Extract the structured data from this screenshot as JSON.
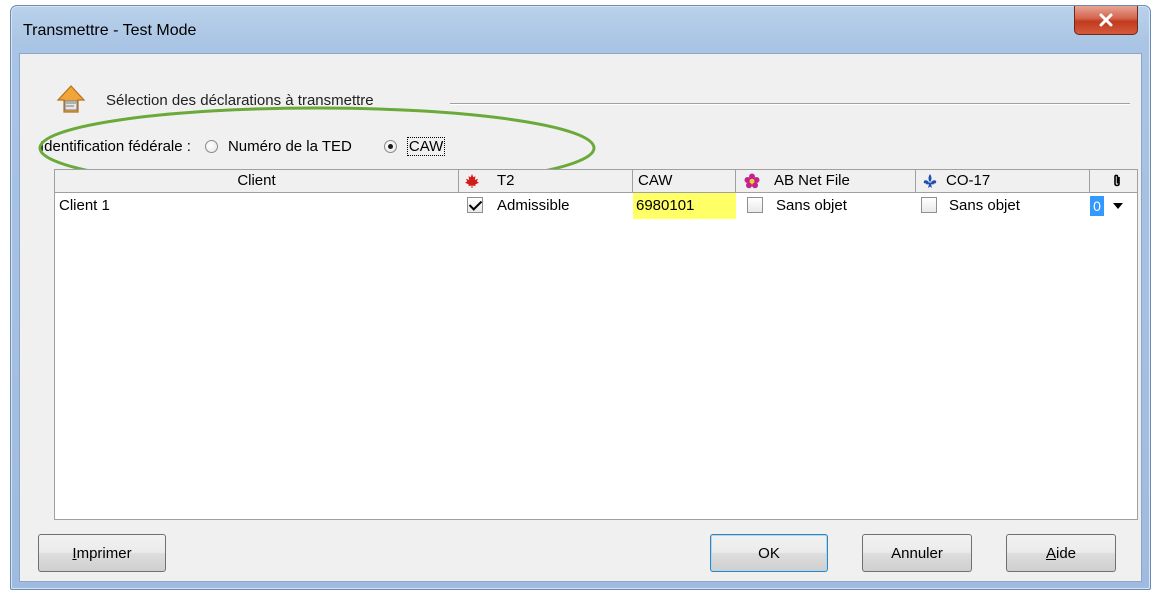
{
  "window": {
    "title": "Transmettre - Test Mode",
    "close_icon": "close-x-icon"
  },
  "section": {
    "title": "Sélection des déclarations à transmettre",
    "icon": "transmit-icon"
  },
  "federal_id": {
    "label": "Identification fédérale :",
    "options": [
      {
        "label": "Numéro de la TED",
        "selected": false
      },
      {
        "label": "CAW",
        "selected": true
      }
    ],
    "highlight_color": "#6aaa3a"
  },
  "grid": {
    "columns": [
      {
        "label": "Client"
      },
      {
        "label": "T2",
        "icon": "maple-leaf-icon"
      },
      {
        "label": "CAW"
      },
      {
        "label": "AB Net File",
        "icon": "alberta-rose-icon"
      },
      {
        "label": "CO-17",
        "icon": "fleur-de-lis-icon"
      },
      {
        "label": "",
        "icon": "paperclip-icon"
      }
    ],
    "rows": [
      {
        "client": "Client 1",
        "t2_checked": true,
        "t2_status": "Admissible",
        "caw": "6980101",
        "ab_checked": false,
        "ab_status": "Sans objet",
        "co17_checked": false,
        "co17_status": "Sans objet",
        "attachments": "0"
      }
    ],
    "caw_highlight": "#ffff66"
  },
  "buttons": {
    "print": {
      "prefix": "",
      "underlined": "I",
      "rest": "mprimer"
    },
    "ok": "OK",
    "cancel": "Annuler",
    "help": {
      "prefix": "",
      "underlined": "A",
      "rest": "ide"
    }
  }
}
